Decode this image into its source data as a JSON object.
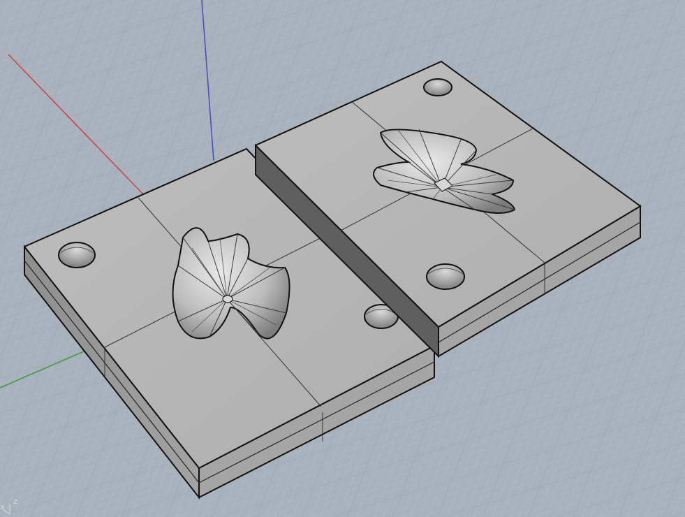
{
  "viewport": {
    "background_color": "#a9b2bc",
    "grid_minor_color": "#b7bfc8",
    "grid_major_color": "#99a3ae",
    "axis_x_color": "#c8484a",
    "axis_y_color": "#3f9a43",
    "axis_z_color": "#4b4ec0",
    "axis_labels": {
      "x": "x",
      "z": "z"
    }
  },
  "model": {
    "face_color": "#b4b4b4",
    "side_color": "#9a9a9a",
    "edge_color": "#111111",
    "hole_count_per_block": 2,
    "blocks": [
      "mold-half-left",
      "mold-half-right"
    ]
  }
}
